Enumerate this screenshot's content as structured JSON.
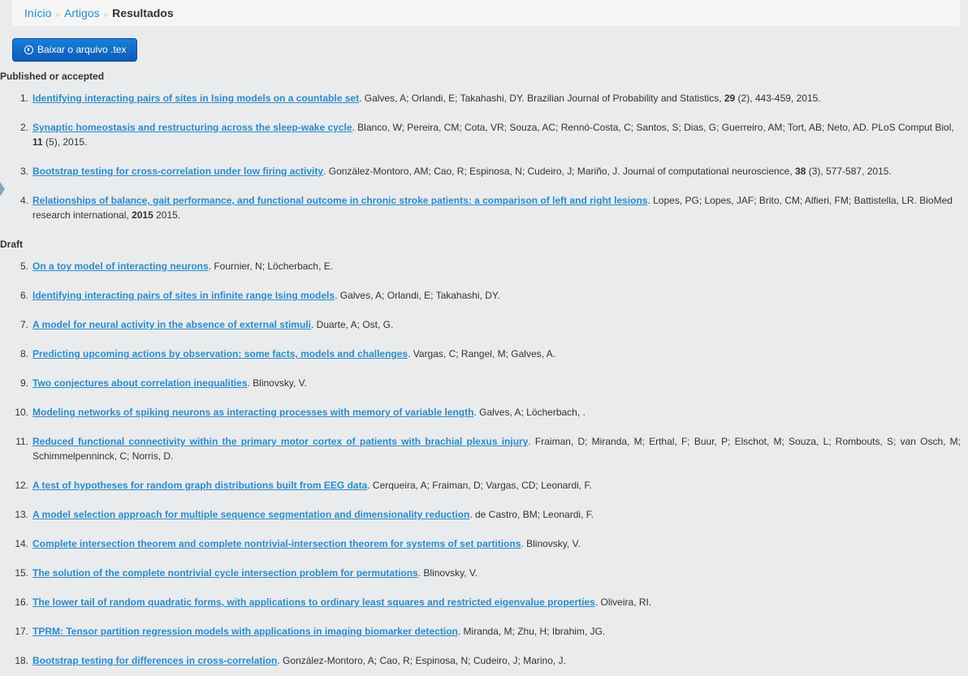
{
  "breadcrumb": {
    "home": "Início",
    "articles": "Artigos",
    "current": "Resultados",
    "separator": "»"
  },
  "download_button": {
    "label": "Baixar o arquivo .tex",
    "icon": "info-circle-icon"
  },
  "sections": {
    "published": "Published or accepted",
    "draft": "Draft"
  },
  "published": [
    {
      "num": "1.",
      "title": "Identifying interacting pairs of sites in Ising models on a countable set",
      "authors": ". Galves, A; Orlandi, E; Takahashi, DY. Brazilian Journal of Probability and Statistics, ",
      "vol": "29",
      "rest": " (2), 443-459, 2015."
    },
    {
      "num": "2.",
      "title": "Synaptic homeostasis and restructuring across the sleep-wake cycle",
      "authors": ". Blanco, W; Pereira, CM; Cota, VR; Souza, AC; Rennó-Costa, C; Santos, S; Dias, G; Guerreiro, AM; Tort, AB; Neto, AD. PLoS Comput Biol, ",
      "vol": "11",
      "rest": " (5), 2015."
    },
    {
      "num": "3.",
      "title": "Bootstrap testing for cross-correlation under low firing activity",
      "authors": ". González-Montoro, AM; Cao, R; Espinosa, N; Cudeiro, J; Mariño, J. Journal of computational neuroscience, ",
      "vol": "38",
      "rest": " (3), 577-587, 2015."
    },
    {
      "num": "4.",
      "title": "Relationships of balance, gait performance, and functional outcome in chronic stroke patients: a comparison of left and right lesions",
      "authors": ". Lopes, PG; Lopes, JAF; Brito, CM; Alfieri, FM; Battistella, LR. BioMed research international, ",
      "vol": "2015",
      "rest": " 2015."
    }
  ],
  "draft": [
    {
      "num": "5.",
      "title": "On a toy model of interacting neurons",
      "authors": ". Fournier, N; Löcherbach, E."
    },
    {
      "num": "6.",
      "title": "Identifying interacting pairs of sites in infinite range Ising models",
      "authors": ". Galves, A; Orlandi, E; Takahashi, DY."
    },
    {
      "num": "7.",
      "title": "A model for neural activity in the absence of external stimuli",
      "authors": ". Duarte, A; Ost, G."
    },
    {
      "num": "8.",
      "title": "Predicting upcoming actions by observation: some facts, models and challenges",
      "authors": ". Vargas, C; Rangel, M; Galves, A."
    },
    {
      "num": "9.",
      "title": "Two conjectures about correlation inequalities",
      "authors": ". Blinovsky, V."
    },
    {
      "num": "10.",
      "title": "Modeling networks of spiking neurons as interacting processes with memory of variable length",
      "authors": ". Galves, A; Löcherbach, ."
    },
    {
      "num": "11.",
      "title": "Reduced functional connectivity within the primary motor cortex of patients with brachial plexus injury",
      "authors": ". Fraiman, D; Miranda, M; Erthal, F; Buur, P; Elschot, M; Souza, L; Rombouts, S; van Osch, M; Schimmelpenninck, C; Norris, D."
    },
    {
      "num": "12.",
      "title": "A test of hypotheses for random graph distributions built from EEG data",
      "authors": ". Cerqueira, A; Fraiman, D; Vargas, CD; Leonardi, F."
    },
    {
      "num": "13.",
      "title": "A model selection approach for multiple sequence segmentation and dimensionality reduction",
      "authors": ". de Castro, BM; Leonardi, F."
    },
    {
      "num": "14.",
      "title": "Complete intersection theorem and complete nontrivial-intersection theorem for systems of set partitions",
      "authors": ". Blinovsky, V."
    },
    {
      "num": "15.",
      "title": "The solution of the complete nontrivial cycle intersection problem for permutations",
      "authors": ". Blinovsky, V."
    },
    {
      "num": "16.",
      "title": "The lower tail of random quadratic forms, with applications to ordinary least squares and restricted eigenvalue properties",
      "authors": ". Oliveira, RI."
    },
    {
      "num": "17.",
      "title": "TPRM: Tensor partition regression models with applications in imaging biomarker detection",
      "authors": ". Miranda, M; Zhu, H; Ibrahim, JG."
    },
    {
      "num": "18.",
      "title": "Bootstrap testing for differences in cross-correlation",
      "authors": ". González-Montoro, A; Cao, R; Espinosa, N; Cudeiro, J; Marino, J."
    }
  ]
}
